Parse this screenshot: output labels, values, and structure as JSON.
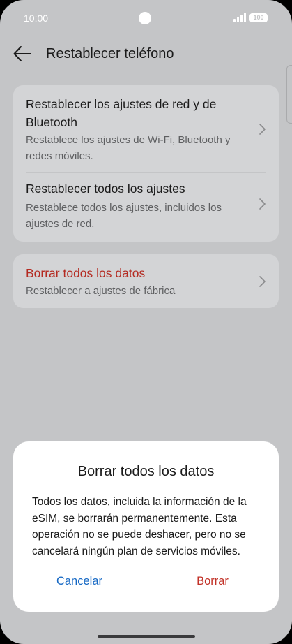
{
  "status_bar": {
    "time": "10:00",
    "battery": "100"
  },
  "header": {
    "title": "Restablecer teléfono"
  },
  "settings": {
    "items": [
      {
        "title": "Restablecer los ajustes de red y de Bluetooth",
        "subtitle": "Restablece los ajustes de Wi-Fi, Bluetooth y redes móviles."
      },
      {
        "title": "Restablecer todos los ajustes",
        "subtitle": "Restablece todos los ajustes, incluidos los ajustes de red."
      },
      {
        "title": "Borrar todos los datos",
        "subtitle": "Restablecer a ajustes de fábrica"
      }
    ]
  },
  "dialog": {
    "title": "Borrar todos los datos",
    "message": "Todos los datos, incluida la información de la eSIM, se borrarán permanentemente. Esta operación no se puede deshacer, pero no se cancelará ningún plan de servicios móviles.",
    "cancel_label": "Cancelar",
    "confirm_label": "Borrar"
  },
  "colors": {
    "background": "#c4c5c7",
    "card": "#d3d4d6",
    "danger": "#b42b22",
    "cancel": "#1568c4",
    "confirm": "#c23228"
  },
  "icons": [
    "back-arrow-icon",
    "chevron-right-icon",
    "signal-icon",
    "battery-icon"
  ]
}
